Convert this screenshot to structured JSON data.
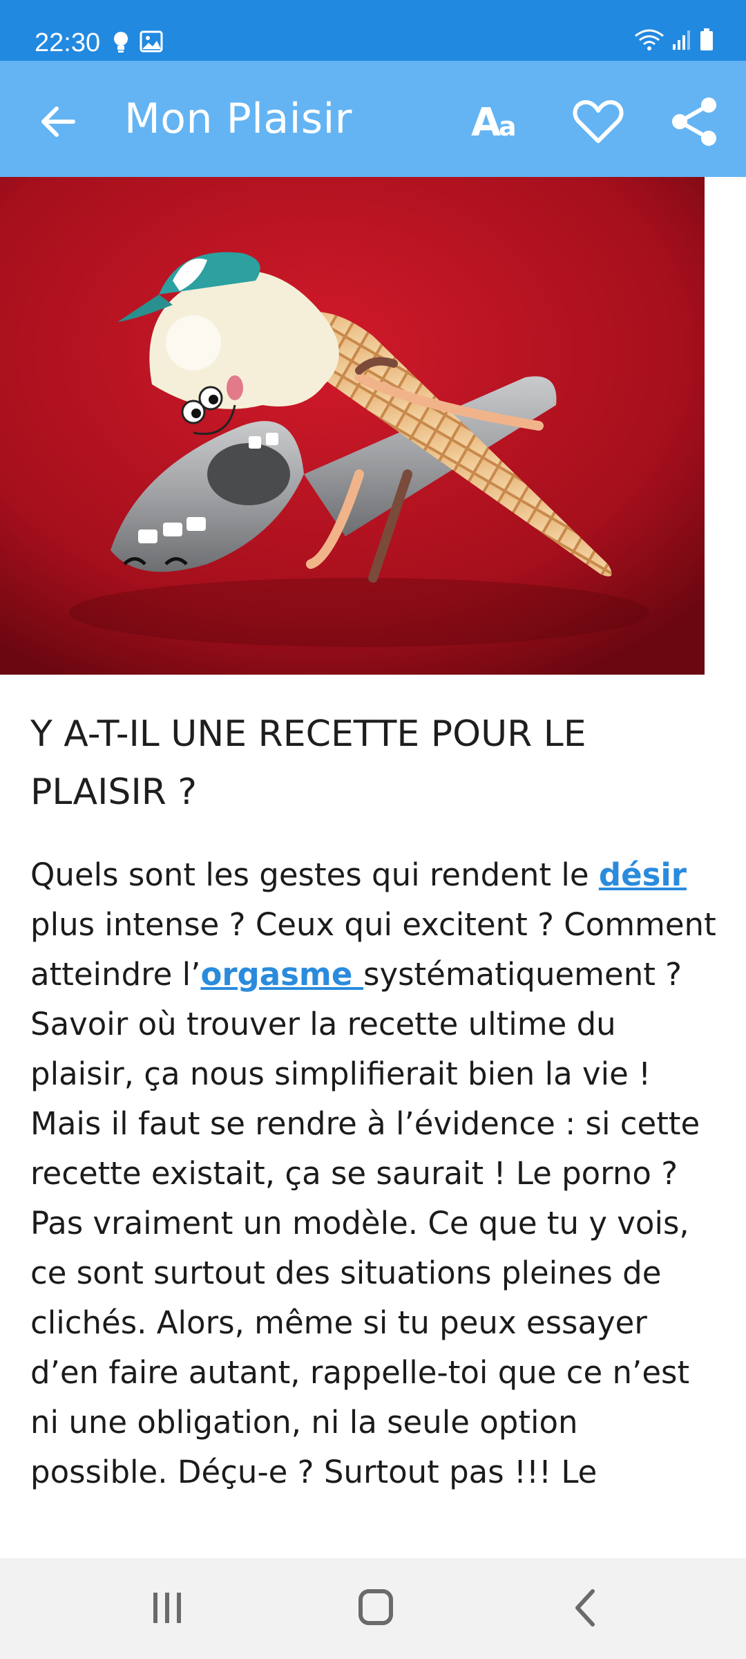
{
  "status_bar": {
    "time": "22:30",
    "left_icons": [
      "bulb-icon",
      "image-icon"
    ],
    "right_icons": [
      "wifi-icon",
      "signal-icon",
      "battery-icon"
    ]
  },
  "app_bar": {
    "title": "Mon Plaisir",
    "back_icon": "arrow-left-icon",
    "font_size_label": "Aa",
    "favorite_icon": "heart-icon",
    "share_icon": "share-icon",
    "background": "#64b4f3"
  },
  "hero": {
    "subject": "ice cream cone on a silver scoop",
    "background": "#b3101e"
  },
  "article": {
    "title": "Y A-T-IL UNE RECETTE POUR LE PLAISIR ?",
    "body": {
      "p1": "Quels sont les gestes qui rendent le ",
      "link1": "désir ",
      "p2": "plus intense ? Ceux qui excitent ? Comment atteindre l’",
      "link2": "orgasme ",
      "p3": "systématiquement ? Savoir où trouver la recette ultime du plaisir, ça nous simplifierait bien la vie ! Mais il faut se rendre à l’évidence : si cette recette existait, ça se saurait ! Le porno ? Pas vraiment un modèle. Ce que tu y vois, ce sont surtout des situations pleines de clichés. Alors, même si tu peux essayer d’en faire autant, rappelle-toi que ce n’est ni une obligation, ni la seule option possible. Déçu-e ? Surtout pas !!! Le"
    },
    "link_color": "#2a8bdc"
  },
  "nav_bar": {
    "recents_icon": "recents-icon",
    "home_icon": "home-icon",
    "back_icon": "back-chevron-icon"
  }
}
